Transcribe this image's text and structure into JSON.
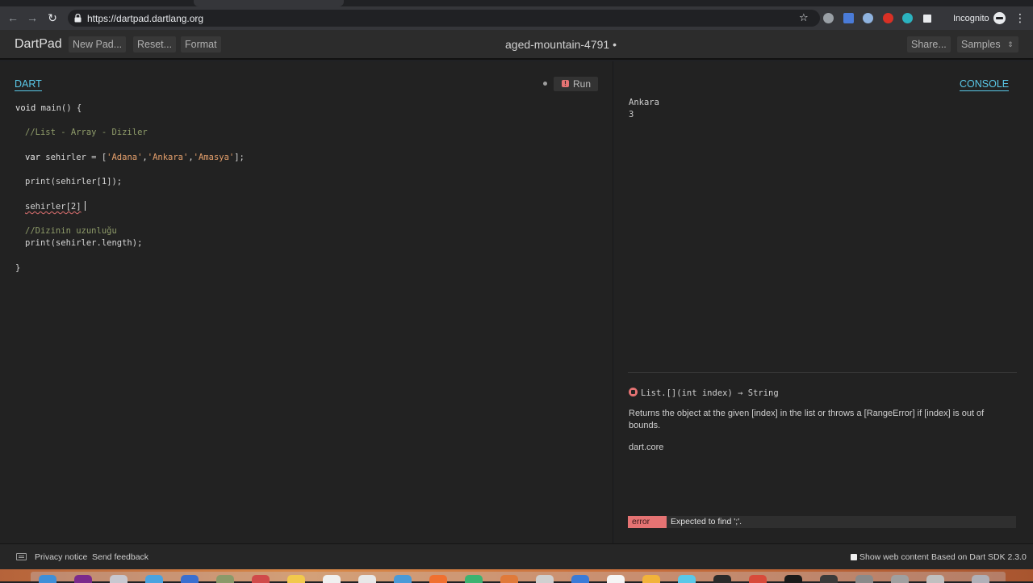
{
  "browser": {
    "url": "https://dartpad.dartlang.org",
    "incognito_label": "Incognito"
  },
  "header": {
    "app_title": "DartPad",
    "new_pad_label": "New Pad...",
    "reset_label": "Reset...",
    "format_label": "Format",
    "pad_name": "aged-mountain-4791 •",
    "share_label": "Share...",
    "samples_label": "Samples"
  },
  "editor": {
    "tab_label": "DART",
    "run_label": "Run",
    "code": {
      "l1_a": "void",
      "l1_b": " main() {",
      "l2": "//List - Array - Diziler",
      "l3_kw": "var",
      "l3_a": " sehirler = [",
      "l3_s1": "'Adana'",
      "l3_c1": ",",
      "l3_s2": "'Ankara'",
      "l3_c2": ",",
      "l3_s3": "'Amasya'",
      "l3_end": "];",
      "l4": "print(sehirler[1]);",
      "l5": "sehirler[2]",
      "l6": "//Dizinin uzunluğu",
      "l7": "print(sehirler.length);",
      "l8": "}"
    }
  },
  "console": {
    "tab_label": "CONSOLE",
    "lines": [
      "Ankara",
      "3"
    ]
  },
  "docs": {
    "signature": "List.[](int index) → String",
    "description": "Returns the object at the given [index] in the list or throws a [RangeError] if [index] is out of bounds.",
    "library": "dart.core"
  },
  "issue": {
    "kind": "error",
    "message": "Expected to find ';'."
  },
  "footer": {
    "privacy_label": "Privacy notice",
    "feedback_label": "Send feedback",
    "web_content_label": "Show web content",
    "sdk_label": "Based on Dart SDK 2.3.0"
  },
  "colors": {
    "accent": "#5ac8e8",
    "error": "#e57373",
    "background": "#222222"
  }
}
